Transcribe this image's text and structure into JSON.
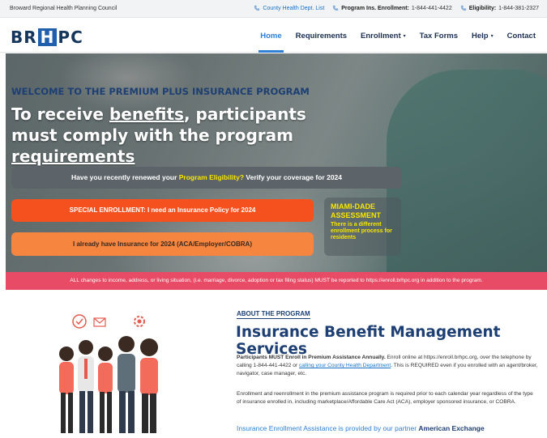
{
  "topbar": {
    "org_name": "Broward Regional Health Planning Council",
    "county_link": "County Health Dept. List",
    "enroll_label": "Program Ins. Enrollment:",
    "enroll_phone": "1-844-441-4422",
    "elig_label": "Eligibility:",
    "elig_phone": "1-844-381-2327"
  },
  "logo": {
    "left": "BR",
    "mid": "H",
    "right": "PC"
  },
  "nav": {
    "items": [
      {
        "label": "Home",
        "active": true
      },
      {
        "label": "Requirements",
        "active": false
      },
      {
        "label": "Enrollment",
        "caret": "▾"
      },
      {
        "label": "Tax Forms"
      },
      {
        "label": "Help",
        "caret": "▾"
      },
      {
        "label": "Contact"
      }
    ]
  },
  "hero": {
    "welcome": "WELCOME TO THE PREMIUM PLUS INSURANCE PROGRAM",
    "headline_a": "To receive ",
    "headline_b": "benefits",
    "headline_c": ", participants must comply with the program ",
    "headline_d": "requirements",
    "renew_a": "Have you recently renewed your ",
    "renew_b": "Program Eligibility?",
    "renew_c": " Verify your coverage for 2024",
    "special": "SPECIAL ENROLLMENT: I need an Insurance Policy for 2024",
    "already": "I already have Insurance for 2024 (ACA/Employer/COBRA)",
    "miami_title": "MIAMI-DADE ASSESSMENT",
    "miami_sub": "There is a different enrollment process for residents",
    "alert": "ALL changes to income, address, or living situation, (i.e. marriage, divorce, adoption or tax filing status) MUST be reported to https://enroll.brhpc.org in addition to the program."
  },
  "about": {
    "kicker": "ABOUT THE PROGRAM",
    "title": "Insurance Benefit Management Services",
    "p1_bold": "Participants MUST Enroll in Premium Assistance Annually.",
    "p1_a": " Enroll online at https://enroll.brhpc.org, over the telephone by calling 1-844-441-4422 or ",
    "p1_link": "calling your County Health Department",
    "p1_b": ". This is REQUIRED even if you enrolled with an agent/broker, navigator, case manager, etc.",
    "p2": "Enrollment and reenrollment in the premium assistance program is required prior to each calendar year regardless of the type of insurance enrolled in, including marketplace/Affordable Care Act (ACA), employer sponsored insurance, or COBRA.",
    "partner_a": "Insurance Enrollment Assistance is provided by our partner ",
    "partner_b": "American Exchange"
  }
}
